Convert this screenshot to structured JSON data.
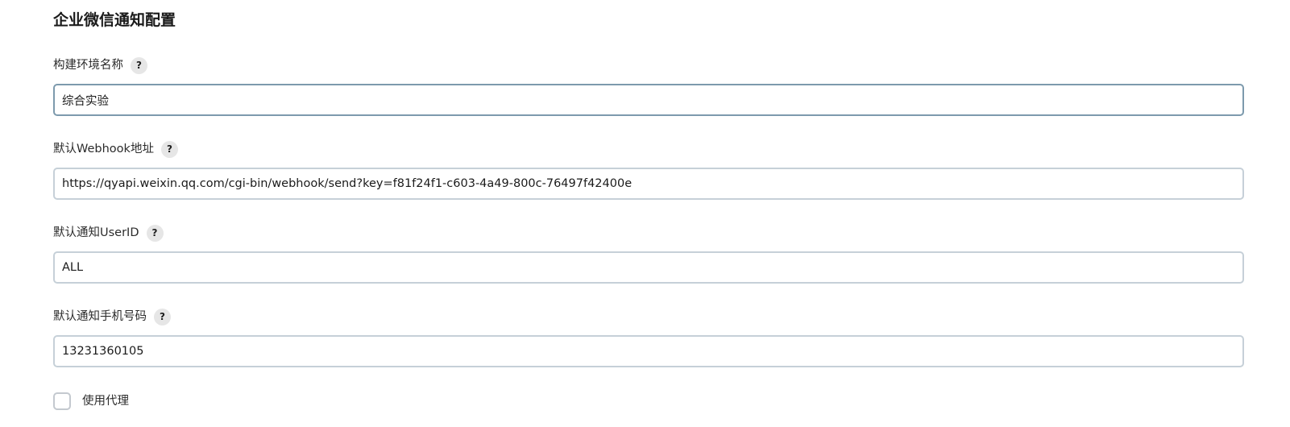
{
  "section": {
    "title": "企业微信通知配置"
  },
  "fields": [
    {
      "label": "构建环境名称",
      "help": "?",
      "value": "综合实验"
    },
    {
      "label": "默认Webhook地址",
      "help": "?",
      "value": "https://qyapi.weixin.qq.com/cgi-bin/webhook/send?key=f81f24f1-c603-4a49-800c-76497f42400e"
    },
    {
      "label": "默认通知UserID",
      "help": "?",
      "value": "ALL"
    },
    {
      "label": "默认通知手机号码",
      "help": "?",
      "value": "13231360105"
    }
  ],
  "proxy": {
    "label": "使用代理",
    "checked": false
  },
  "colors": {
    "input_border": "#c6d0d8",
    "input_border_focused": "#7d9aad",
    "help_icon_bg": "#e6e6e6"
  }
}
